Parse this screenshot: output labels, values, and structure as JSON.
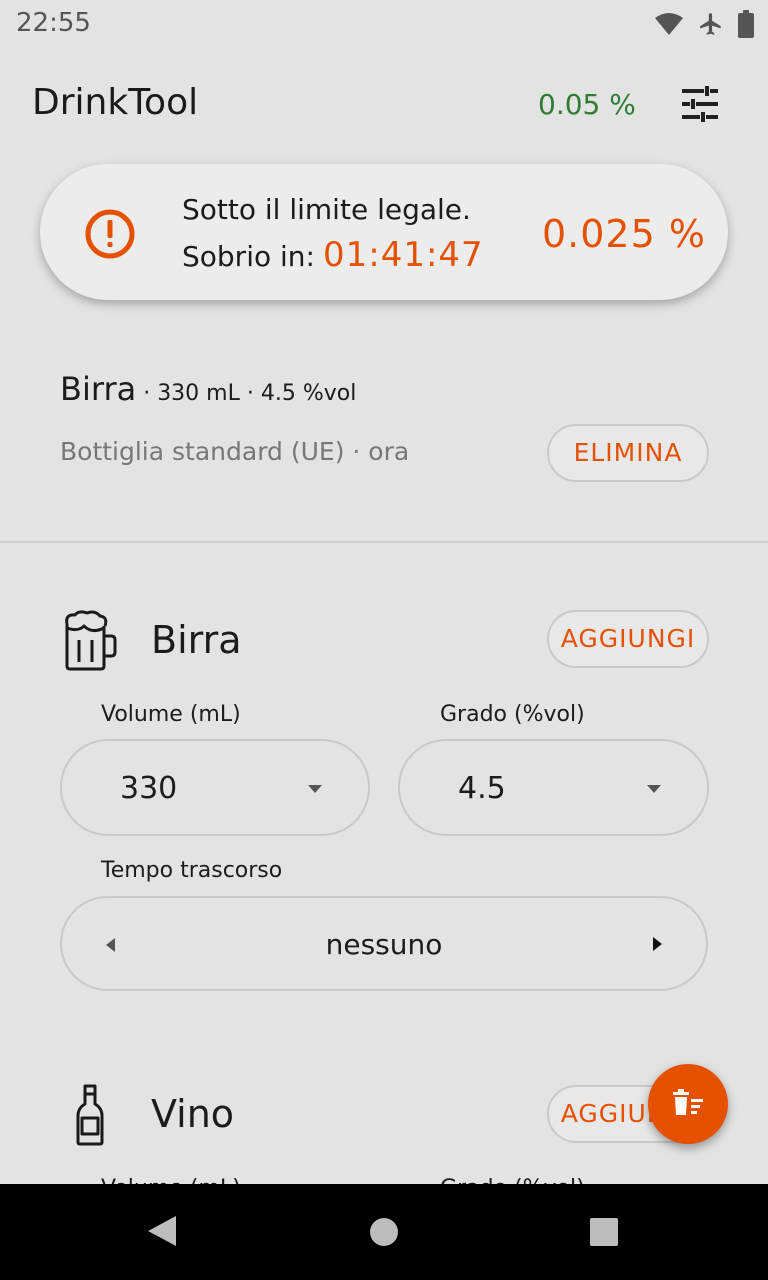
{
  "status_bar": {
    "time": "22:55"
  },
  "app_bar": {
    "title": "DrinkTool",
    "bac": "0.05 %"
  },
  "status_card": {
    "line1": "Sotto il limite legale.",
    "sober_label": "Sobrio in:",
    "sober_time": "01:41:47",
    "bac": "0.025 %"
  },
  "last_entry": {
    "name": "Birra",
    "dot1": " · ",
    "volume": "330",
    "unit": " mL · ",
    "abv": "4.5 %vol",
    "subtitle": "Bottiglia standard (UE) · ora",
    "delete_label": "ELIMINA"
  },
  "beer_card": {
    "title": "Birra",
    "add_label": "AGGIUNGI",
    "volume_label": "Volume (mL)",
    "volume_value": "330",
    "abv_label": "Grado (%vol)",
    "abv_value": "4.5",
    "time_label": "Tempo trascorso",
    "time_value": "nessuno"
  },
  "wine_card": {
    "title": "Vino",
    "add_label": "AGGIUNGI",
    "volume_label": "Volume (mL)",
    "abv_label": "Grado (%vol)"
  },
  "colors": {
    "accent": "#e65100",
    "positive": "#2e7d32",
    "background": "#e3e3e3"
  },
  "icons": [
    "wifi-icon",
    "airplane-icon",
    "battery-icon",
    "tune-icon",
    "warning-icon",
    "beer-mug-icon",
    "wine-bottle-icon",
    "clear-list-icon",
    "nav-back-icon",
    "nav-home-icon",
    "nav-recents-icon"
  ]
}
